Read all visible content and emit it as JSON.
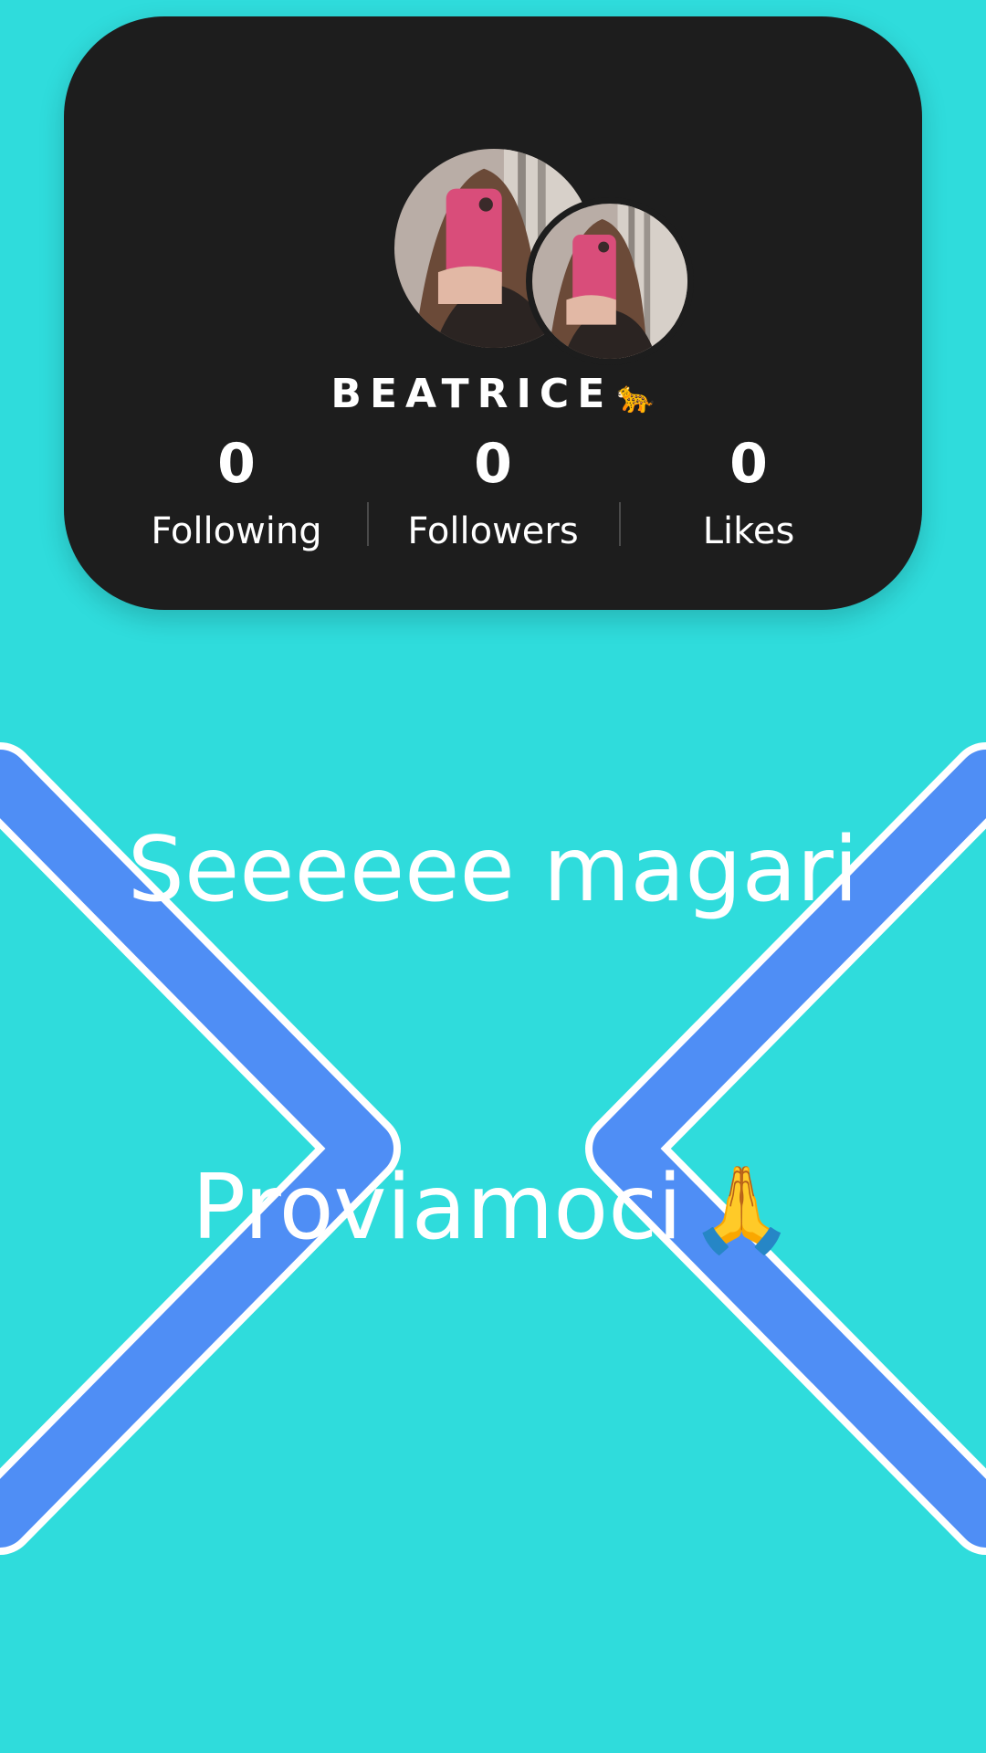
{
  "colors": {
    "background": "#2fdcdc",
    "card": "#1d1d1d",
    "chevron": "#4f8ef5",
    "text": "#ffffff"
  },
  "profile": {
    "username": "BEATRICE",
    "username_emoji": "🐆",
    "avatar_icon": "profile-photo",
    "stats": [
      {
        "value": "0",
        "label": "Following"
      },
      {
        "value": "0",
        "label": "Followers"
      },
      {
        "value": "0",
        "label": "Likes"
      }
    ]
  },
  "caption": {
    "line1": "Seeeeee magari",
    "line2": "Proviamoci",
    "line2_emoji": "🙏"
  }
}
